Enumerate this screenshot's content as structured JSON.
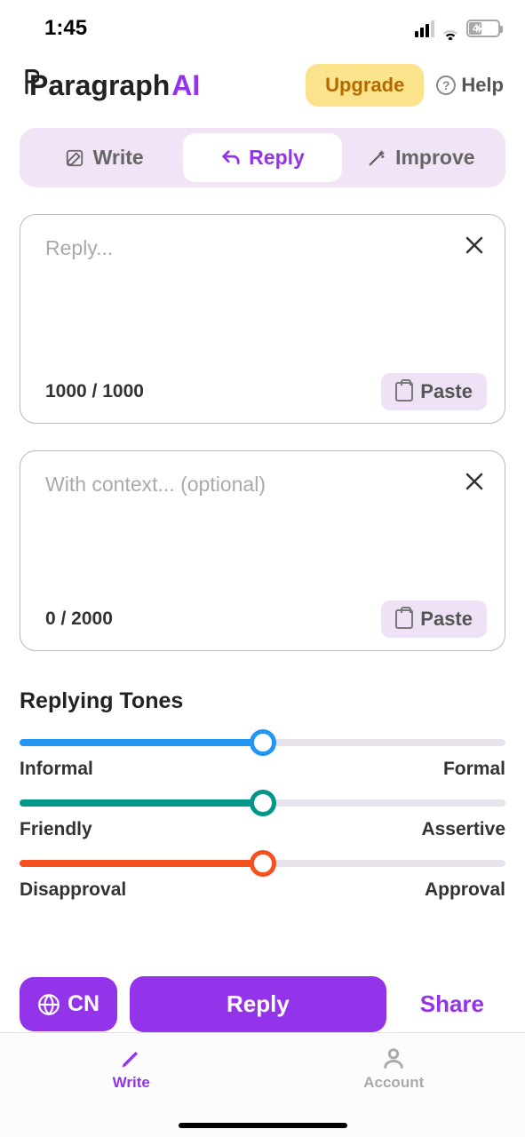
{
  "status": {
    "time": "1:45",
    "battery": "4"
  },
  "header": {
    "logo_main": "Paragraph",
    "logo_ai": "AI",
    "upgrade": "Upgrade",
    "help": "Help"
  },
  "tabs": {
    "write": "Write",
    "reply": "Reply",
    "improve": "Improve"
  },
  "reply_input": {
    "placeholder": "Reply...",
    "counter": "1000 / 1000",
    "paste": "Paste"
  },
  "context_input": {
    "placeholder": "With context... (optional)",
    "counter": "0 / 2000",
    "paste": "Paste"
  },
  "tones": {
    "title": "Replying Tones",
    "sliders": [
      {
        "left": "Informal",
        "right": "Formal",
        "color": "#2196f3",
        "value": 50
      },
      {
        "left": "Friendly",
        "right": "Assertive",
        "color": "#009688",
        "value": 50
      },
      {
        "left": "Disapproval",
        "right": "Approval",
        "color": "#f4511e",
        "value": 50
      }
    ]
  },
  "actions": {
    "lang": "CN",
    "reply": "Reply",
    "share": "Share"
  },
  "nav": {
    "write": "Write",
    "account": "Account"
  }
}
